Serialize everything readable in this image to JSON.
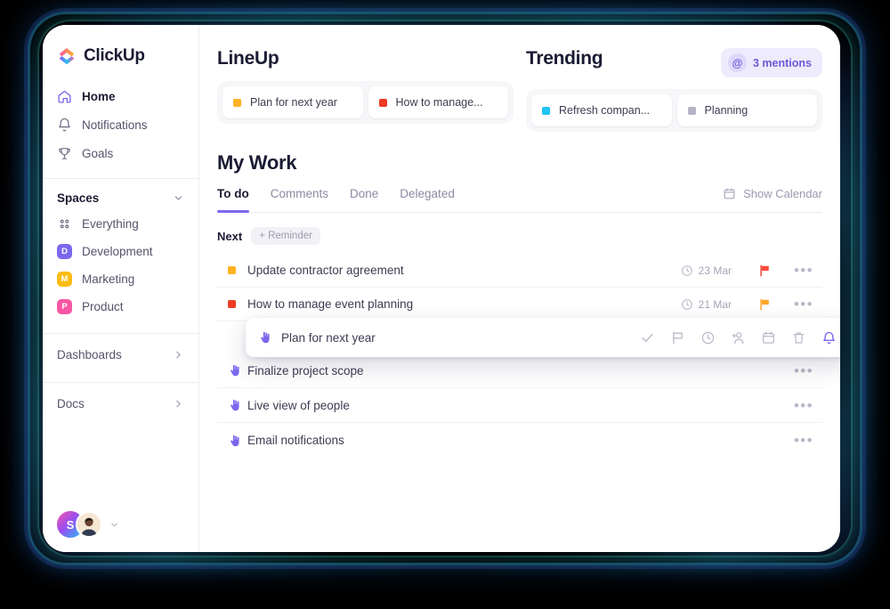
{
  "brand": {
    "name": "ClickUp"
  },
  "sidebar": {
    "nav": [
      {
        "label": "Home",
        "icon": "home-icon",
        "active": true
      },
      {
        "label": "Notifications",
        "icon": "bell-icon",
        "active": false
      },
      {
        "label": "Goals",
        "icon": "trophy-icon",
        "active": false
      }
    ],
    "spaces_title": "Spaces",
    "spaces": [
      {
        "label": "Everything",
        "badge": "",
        "color": "",
        "icon": "grid-dots-icon"
      },
      {
        "label": "Development",
        "badge": "D",
        "color": "#7b68ee"
      },
      {
        "label": "Marketing",
        "badge": "M",
        "color": "#fbbc14"
      },
      {
        "label": "Product",
        "badge": "P",
        "color": "#f957a5"
      }
    ],
    "links": [
      {
        "label": "Dashboards"
      },
      {
        "label": "Docs"
      }
    ],
    "user": {
      "initial": "S"
    }
  },
  "lineup": {
    "title": "LineUp",
    "items": [
      {
        "label": "Plan for next year",
        "color": "#ffb224"
      },
      {
        "label": "How to manage...",
        "color": "#ef3b24"
      }
    ]
  },
  "trending": {
    "title": "Trending",
    "mentions": {
      "count_label": "3 mentions",
      "icon": "at-icon"
    },
    "items": [
      {
        "label": "Refresh compan...",
        "color": "#22c3f3"
      },
      {
        "label": "Planning",
        "color": "#b4b4c4"
      }
    ]
  },
  "mywork": {
    "title": "My Work",
    "tabs": [
      {
        "label": "To do",
        "active": true
      },
      {
        "label": "Comments",
        "active": false
      },
      {
        "label": "Done",
        "active": false
      },
      {
        "label": "Delegated",
        "active": false
      }
    ],
    "calendar_button": {
      "label": "Show Calendar",
      "icon": "calendar-icon"
    },
    "group_label": "Next",
    "reminder_button": "+ Reminder",
    "tasks": [
      {
        "title": "Update contractor agreement",
        "marker": "square",
        "marker_color": "#ffb224",
        "due": "23 Mar",
        "flag_color": "#fb4a3c",
        "menu": "•••"
      },
      {
        "title": "How to manage event planning",
        "marker": "square",
        "marker_color": "#ef3b24",
        "due": "21 Mar",
        "flag_color": "#ffa62b",
        "menu": "•••"
      },
      {
        "title": "Finalize project scope",
        "marker": "reminder",
        "marker_color": "#7b68ee",
        "due": "",
        "flag_color": "",
        "menu": "•••"
      },
      {
        "title": "Live view of people",
        "marker": "reminder",
        "marker_color": "#7b68ee",
        "due": "",
        "flag_color": "",
        "menu": "•••"
      },
      {
        "title": "Email notifications",
        "marker": "reminder",
        "marker_color": "#7b68ee",
        "due": "",
        "flag_color": "",
        "menu": "•••"
      }
    ]
  },
  "dragcard": {
    "title": "Plan for next year",
    "actions": [
      {
        "name": "check-icon"
      },
      {
        "name": "flag-icon"
      },
      {
        "name": "clock-icon"
      },
      {
        "name": "assign-user-icon"
      },
      {
        "name": "calendar-icon"
      },
      {
        "name": "trash-icon"
      },
      {
        "name": "bell-icon"
      }
    ]
  },
  "colors": {
    "accent": "#7b68ee",
    "mention_bg": "#eeebfc",
    "text_dark": "#1b1b33",
    "text_muted": "#8a8aa3",
    "background": "#000000"
  }
}
